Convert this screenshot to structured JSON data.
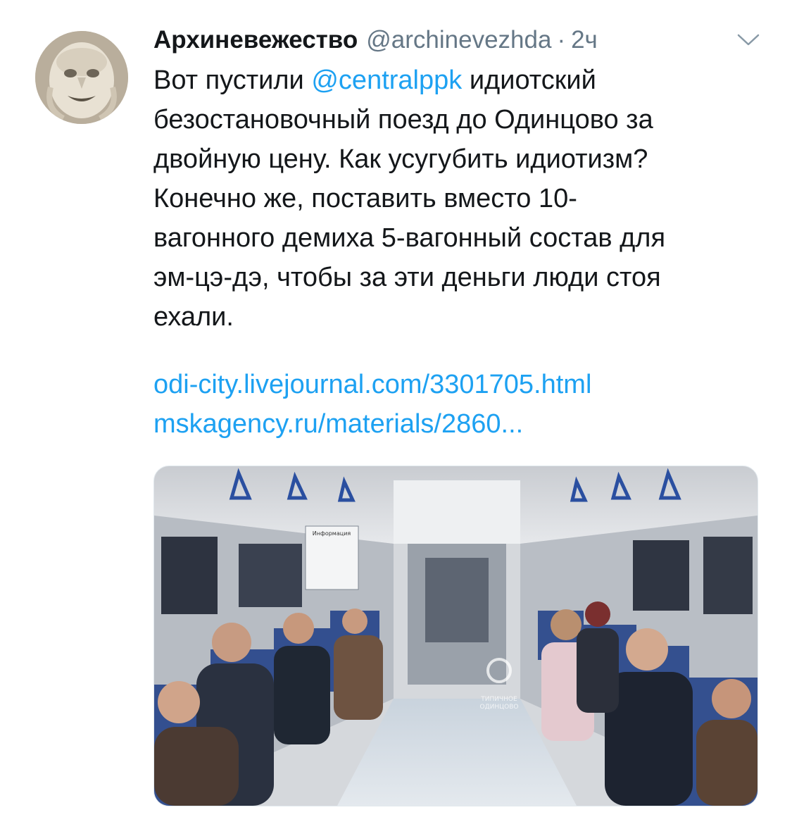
{
  "author": {
    "display_name": "Архиневежество",
    "handle": "@archinevezhda",
    "separator": "·",
    "time": "2ч"
  },
  "icons": {
    "caret": "chevron-down-icon"
  },
  "colors": {
    "link": "#1da1f2",
    "secondary_text": "#657786",
    "text": "#14171a"
  },
  "tweet": {
    "line1_before": "Вот пустили ",
    "mention": "@centralppk",
    "line1_after": " идиотский",
    "line2": "безостановочный поезд до Одинцово за",
    "line3": "двойную цену. Как усугубить идиотизм?",
    "line4": "Конечно же, поставить вместо 10-",
    "line5": "вагонного демиха 5-вагонный состав для",
    "line6": "эм-цэ-дэ, чтобы за эти деньги люди стоя",
    "line7": "ехали."
  },
  "links": [
    "odi-city.livejournal.com/3301705.html",
    "mskagency.ru/materials/2860..."
  ],
  "media": {
    "info_board_text": "Информация",
    "watermark_line1": "ТИПИЧНОЕ",
    "watermark_line2": "ОДИНЦОВО"
  }
}
